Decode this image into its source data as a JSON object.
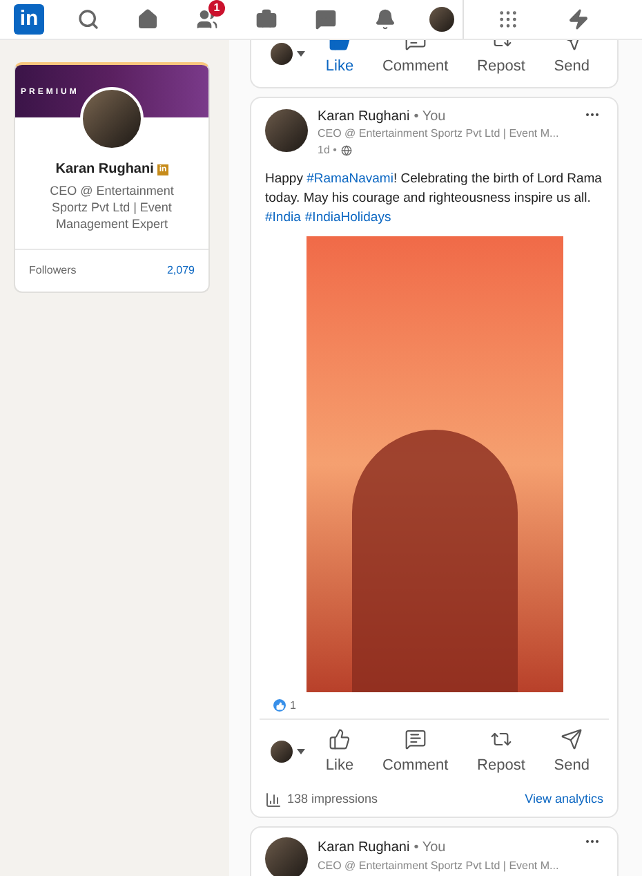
{
  "nav": {
    "items": [
      {
        "kind": "logo",
        "label": "in"
      },
      {
        "kind": "search"
      },
      {
        "kind": "home"
      },
      {
        "kind": "network",
        "badge": "1"
      },
      {
        "kind": "jobs"
      },
      {
        "kind": "messaging"
      },
      {
        "kind": "notifications"
      },
      {
        "kind": "me"
      },
      {
        "kind": "apps"
      },
      {
        "kind": "premium"
      }
    ]
  },
  "profile_card": {
    "banner_label": "PREMIUM",
    "name": "Karan Rughani",
    "badge": "in",
    "headline": "CEO @ Entertainment Sportz Pvt Ltd | Event Management Expert",
    "stats": [
      {
        "label": "Followers",
        "value": "2,079"
      }
    ]
  },
  "previous_post": {
    "actions": [
      {
        "kind": "like",
        "label": "Like",
        "selected": true
      },
      {
        "kind": "comment",
        "label": "Comment",
        "selected": false
      },
      {
        "kind": "repost",
        "label": "Repost",
        "selected": false
      },
      {
        "kind": "send",
        "label": "Send",
        "selected": false
      }
    ]
  },
  "post": {
    "author": "Karan Rughani",
    "relation": "• You",
    "headline": "CEO @ Entertainment Sportz Pvt Ltd | Event M...",
    "time": "1d •",
    "text": [
      {
        "kind": "plain",
        "text": "Happy "
      },
      {
        "kind": "hashtag",
        "text": "#RamaNavami"
      },
      {
        "kind": "plain",
        "text": "! Celebrating the birth of Lord Rama today. May his courage and righteousness inspire us all. "
      },
      {
        "kind": "hashtag",
        "text": "#India"
      },
      {
        "kind": "hashtag",
        "text": "#IndiaHolidays"
      }
    ],
    "reaction_count": "1",
    "actions": [
      {
        "kind": "like",
        "label": "Like",
        "selected": false
      },
      {
        "kind": "comment",
        "label": "Comment",
        "selected": false
      },
      {
        "kind": "repost",
        "label": "Repost",
        "selected": false
      },
      {
        "kind": "send",
        "label": "Send",
        "selected": false
      }
    ],
    "impressions": "138 impressions",
    "analytics_link": "View analytics"
  },
  "next_post": {
    "author": "Karan Rughani",
    "relation": "• You",
    "headline": "CEO @ Entertainment Sportz Pvt Ltd | Event M..."
  }
}
